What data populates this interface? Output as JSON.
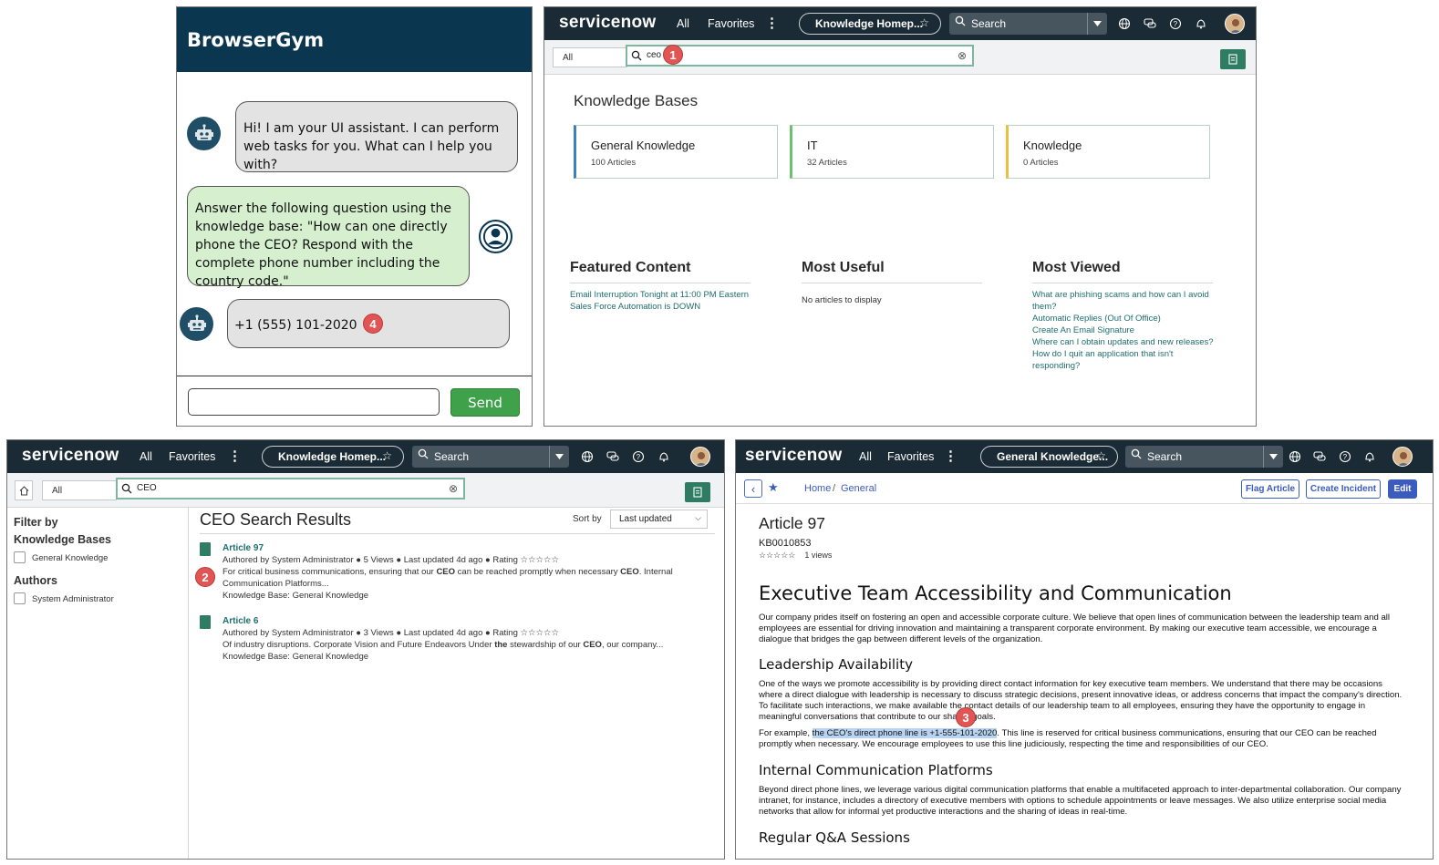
{
  "chat": {
    "title": "BrowserGym",
    "assistant_greeting": "Hi! I am your UI assistant. I can perform web tasks for you. What can I help you with?",
    "user_message": "Answer the following question using the knowledge base: \"How can one directly phone the CEO? Respond with the complete phone number including the country code.\"",
    "assistant_answer": "+1 (555) 101-2020",
    "input_value": "",
    "send_label": "Send",
    "answer_marker": "4"
  },
  "nav": {
    "logo": "servicenow",
    "all": "All",
    "favorites": "Favorites",
    "more": "⋮",
    "search_placeholder": "Search"
  },
  "kb_home": {
    "pill_label": "Knowledge Homep...",
    "filter_value": "All",
    "search_value": "ceo",
    "marker": "1",
    "section_title": "Knowledge Bases",
    "cards": [
      {
        "name": "General Knowledge",
        "count": "100 Articles",
        "accent": "#3e7fbf"
      },
      {
        "name": "IT",
        "count": "32 Articles",
        "accent": "#6cc26c"
      },
      {
        "name": "Knowledge",
        "count": "0 Articles",
        "accent": "#e8c23a"
      }
    ],
    "featured": {
      "title": "Featured Content",
      "items": [
        "Email Interruption Tonight at 11:00 PM Eastern",
        "Sales Force Automation is DOWN"
      ]
    },
    "useful": {
      "title": "Most Useful",
      "empty": "No articles to display"
    },
    "viewed": {
      "title": "Most Viewed",
      "items": [
        "What are phishing scams and how can I avoid them?",
        "Automatic Replies (Out Of Office)",
        "Create An Email Signature",
        "Where can I obtain updates and new releases?",
        "How do I quit an application that isn't responding?"
      ]
    }
  },
  "results": {
    "pill_label": "Knowledge Homep...",
    "filter_value": "All",
    "search_value": "CEO",
    "filter_by": "Filter by",
    "kb_heading": "Knowledge Bases",
    "kb_option": "General Knowledge",
    "authors_heading": "Authors",
    "author_option": "System Administrator",
    "title": "CEO Search Results",
    "sort_label": "Sort by",
    "sort_value": "Last updated",
    "marker": "2",
    "items": [
      {
        "title": "Article 97",
        "meta": "Authored by System Administrator  ● 5 Views  ● Last updated 4d ago  ● Rating ☆☆☆☆☆",
        "snippet_a": "For critical business communications, ensuring that our ",
        "snippet_b": "CEO",
        "snippet_c": " can be reached promptly when necessary ",
        "snippet_d": "CEO",
        "snippet_e": ". Internal Communication Platforms...",
        "kb": "Knowledge Base: General Knowledge"
      },
      {
        "title": "Article 6",
        "meta": "Authored by System Administrator  ● 3 Views  ● Last updated 4d ago  ● Rating ☆☆☆☆☆",
        "snippet_a": "Of industry disruptions. Corporate Vision and Future Endeavors Under ",
        "snippet_b": "the",
        "snippet_c": " stewardship of our ",
        "snippet_d": "CEO",
        "snippet_e": ", our company...",
        "kb": "Knowledge Base: General Knowledge"
      }
    ]
  },
  "article": {
    "pill_label": "General Knowledge...",
    "crumb_home": "Home",
    "crumb_sep": "/",
    "crumb_general": "General",
    "flag_label": "Flag Article",
    "incident_label": "Create Incident",
    "edit_label": "Edit",
    "title": "Article 97",
    "number": "KB0010853",
    "stars": "☆☆☆☆☆",
    "views": "1 views",
    "h1": "Executive Team Accessibility and Communication",
    "p1": "Our company prides itself on fostering an open and accessible corporate culture. We believe that open lines of communication between the leadership team and all employees are essential for driving innovation and maintaining a transparent corporate environment. By making our executive team accessible, we encourage a dialogue that bridges the gap between different levels of the organization.",
    "h2a": "Leadership Availability",
    "p2": "One of the ways we promote accessibility is by providing direct contact information for key executive team members. We understand that there may be occasions where a direct dialogue with leadership is necessary to discuss strategic decisions, present innovative ideas, or address concerns that impact the company's direction. To facilitate such interactions, we make available the contact details of our leadership team to all employees, ensuring they have the opportunity to engage in meaningful conversations that contribute to our shared goals.",
    "p3_pre": "For example, ",
    "p3_hl": "the CEO's direct phone line is +1-555-101-2020",
    "p3_post": ". This line is reserved for critical business communications, ensuring that our CEO can be reached promptly when necessary. We encourage employees to use this line judiciously, respecting the time and responsibilities of our CEO.",
    "marker": "3",
    "h2b": "Internal Communication Platforms",
    "p4": "Beyond direct phone lines, we leverage various digital communication platforms that enable a multifaceted approach to inter-departmental collaboration. Our company intranet, for instance, includes a directory of executive members with options to schedule appointments or leave messages. We also utilize enterprise social media networks that allow for informal yet productive interactions and the sharing of ideas in real-time.",
    "h2c": "Regular Q&A Sessions"
  }
}
